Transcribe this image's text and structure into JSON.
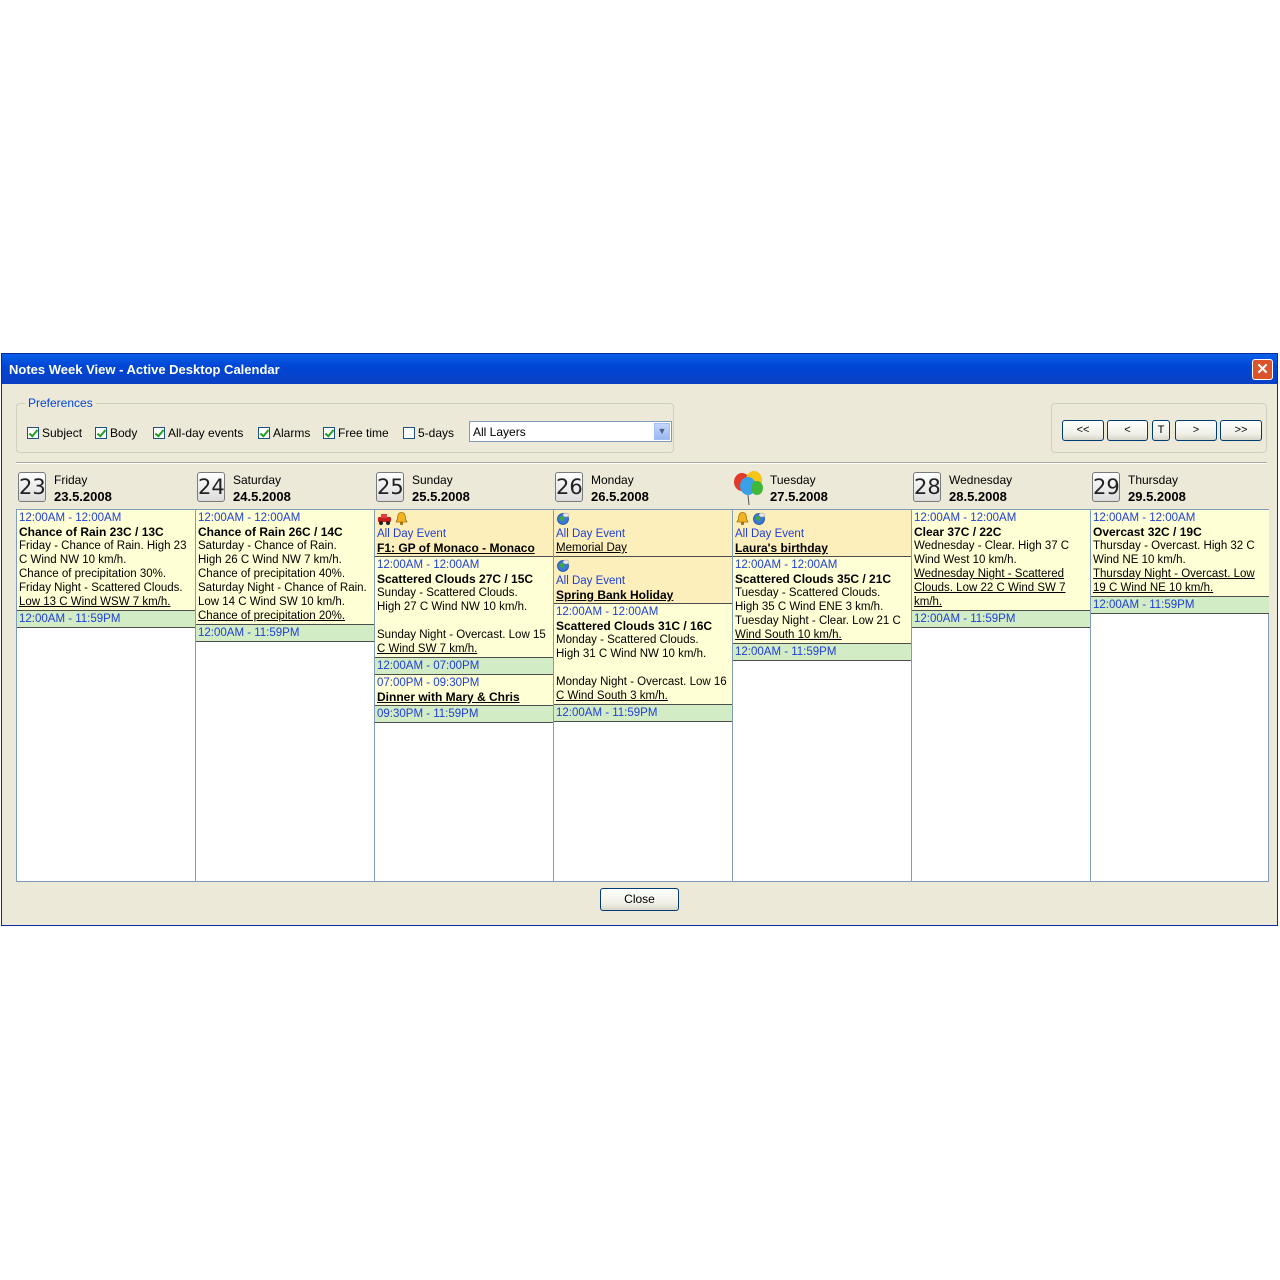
{
  "window": {
    "title": "Notes Week View - Active Desktop Calendar",
    "close_glyph": "✕"
  },
  "preferences": {
    "legend": "Preferences",
    "checkboxes": [
      {
        "label": "Subject",
        "checked": true
      },
      {
        "label": "Body",
        "checked": true
      },
      {
        "label": "All-day events",
        "checked": true
      },
      {
        "label": "Alarms",
        "checked": true
      },
      {
        "label": "Free time",
        "checked": true
      },
      {
        "label": "5-days",
        "checked": false
      }
    ],
    "layer_select": {
      "value": "All Layers"
    }
  },
  "nav": {
    "first": "<<",
    "prev": "<",
    "today": "T",
    "next": ">",
    "last": ">>"
  },
  "days": [
    {
      "num": "23",
      "name": "Friday",
      "date": "23.5.2008",
      "events": [
        {
          "style": "yellow",
          "time": "12:00AM - 12:00AM",
          "subject": "Chance of Rain 23C / 13C",
          "body": [
            "Friday - Chance of Rain.        High 23 C  Wind NW  10 km/h.",
            "Chance of precipitation 30%.",
            "Friday Night - Scattered Clouds.",
            "Low 13 C  Wind WSW  7 km/h."
          ]
        },
        {
          "style": "green",
          "time": "12:00AM - 11:59PM"
        }
      ]
    },
    {
      "num": "24",
      "name": "Saturday",
      "date": "24.5.2008",
      "events": [
        {
          "style": "yellow",
          "time": "12:00AM - 12:00AM",
          "subject": "Chance of Rain 26C / 14C",
          "body": [
            "Saturday - Chance of Rain.",
            "High 26 C  Wind NW  7 km/h.",
            "Chance of precipitation 40%.",
            "Saturday Night - Chance of Rain.",
            "Low 14 C  Wind SW  10 km/h.",
            "Chance of precipitation 20%."
          ]
        },
        {
          "style": "green",
          "time": "12:00AM - 11:59PM"
        }
      ]
    },
    {
      "num": "25",
      "name": "Sunday",
      "date": "25.5.2008",
      "events": [
        {
          "style": "orange",
          "icons": [
            "car-icon",
            "bell-icon"
          ],
          "time": "All Day Event",
          "subject": "F1: GP of Monaco - Monaco"
        },
        {
          "style": "yellow",
          "time": "12:00AM - 12:00AM",
          "subject": "Scattered Clouds 27C / 15C",
          "body": [
            "Sunday - Scattered Clouds.",
            "High 27 C  Wind NW  10 km/h.",
            "",
            "Sunday Night - Overcast. Low 15",
            "C  Wind SW  7 km/h."
          ]
        },
        {
          "style": "green",
          "time": "12:00AM - 07:00PM"
        },
        {
          "style": "yellow",
          "time": "07:00PM - 09:30PM",
          "subject": "Dinner with Mary & Chris"
        },
        {
          "style": "green",
          "time": "09:30PM - 11:59PM"
        }
      ]
    },
    {
      "num": "26",
      "name": "Monday",
      "date": "26.5.2008",
      "events": [
        {
          "style": "orange",
          "icons": [
            "globe-icon"
          ],
          "time": "All Day Event",
          "subject": "",
          "body": [
            "Memorial Day"
          ]
        },
        {
          "style": "orange",
          "icons": [
            "globe-icon"
          ],
          "time": "All Day Event",
          "subject": "Spring Bank Holiday"
        },
        {
          "style": "yellow",
          "time": "12:00AM - 12:00AM",
          "subject": "Scattered Clouds 31C / 16C",
          "body": [
            "Monday - Scattered Clouds.",
            "High 31 C  Wind NW  10 km/h.",
            "",
            "Monday Night - Overcast. Low 16",
            "C  Wind South  3 km/h."
          ]
        },
        {
          "style": "green",
          "time": "12:00AM - 11:59PM"
        }
      ]
    },
    {
      "num": "",
      "name": "Tuesday",
      "date": "27.5.2008",
      "balloon": true,
      "events": [
        {
          "style": "orange",
          "icons": [
            "bell-icon",
            "globe-icon"
          ],
          "time": "All Day Event",
          "subject": "Laura's birthday"
        },
        {
          "style": "yellow",
          "time": "12:00AM - 12:00AM",
          "subject": "Scattered Clouds 35C / 21C",
          "body": [
            "Tuesday - Scattered Clouds.",
            "High 35 C  Wind ENE  3 km/h.",
            "Tuesday Night - Clear. Low 21 C",
            "Wind South  10 km/h."
          ]
        },
        {
          "style": "green",
          "time": "12:00AM - 11:59PM"
        }
      ]
    },
    {
      "num": "28",
      "name": "Wednesday",
      "date": "28.5.2008",
      "events": [
        {
          "style": "yellow",
          "time": "12:00AM - 12:00AM",
          "subject": "Clear 37C / 22C",
          "body": [
            "Wednesday - Clear.        High 37 C  Wind West  10 km/h.",
            "Wednesday Night - Scattered Clouds. Low 22 C  Wind SW  7 km/h."
          ]
        },
        {
          "style": "green",
          "time": "12:00AM - 11:59PM"
        }
      ]
    },
    {
      "num": "29",
      "name": "Thursday",
      "date": "29.5.2008",
      "events": [
        {
          "style": "yellow",
          "time": "12:00AM - 12:00AM",
          "subject": "Overcast 32C / 19C",
          "body": [
            "Thursday - Overcast.        High 32 C  Wind NE  10 km/h.",
            "Thursday Night - Overcast. Low 19 C  Wind NE  10 km/h."
          ]
        },
        {
          "style": "green",
          "time": "12:00AM - 11:59PM"
        }
      ]
    }
  ],
  "close_button": "Close"
}
